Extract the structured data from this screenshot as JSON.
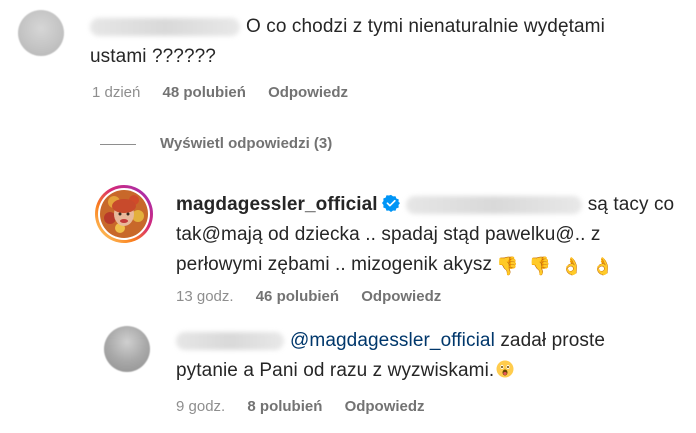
{
  "comment1": {
    "text_line1": "O co chodzi z tymi nienaturalnie wydętami",
    "text_line2": "ustami ??????",
    "time": "1 dzień",
    "likes": "48 polubień",
    "reply": "Odpowiedz"
  },
  "view_replies": {
    "label": "Wyświetl odpowiedzi (3)"
  },
  "reply1": {
    "username": "magdagessler_official",
    "text_line1_tail": "są tacy co",
    "text_line2": "tak@mają od dziecka .. spadaj stąd pawelku@.. z",
    "text_line3": "perłowymi zębami .. mizogenik akysz",
    "emojis": [
      "👎",
      "👎",
      "👌",
      "👌"
    ],
    "time": "13 godz.",
    "likes": "46 polubień",
    "reply": "Odpowiedz"
  },
  "reply2": {
    "mention": "@magdagessler_official",
    "text_line1_tail": "zadał proste",
    "text_line2": "pytanie a Pani od razu z wyzwiskami.",
    "time": "9 godz.",
    "likes": "8 polubień",
    "reply": "Odpowiedz"
  },
  "colors": {
    "text": "#262626",
    "meta": "#737373",
    "mention": "#00376b",
    "verified": "#0095f6"
  },
  "icons": {
    "verified": "verified-badge-icon",
    "wow": "astonished-face-icon"
  }
}
